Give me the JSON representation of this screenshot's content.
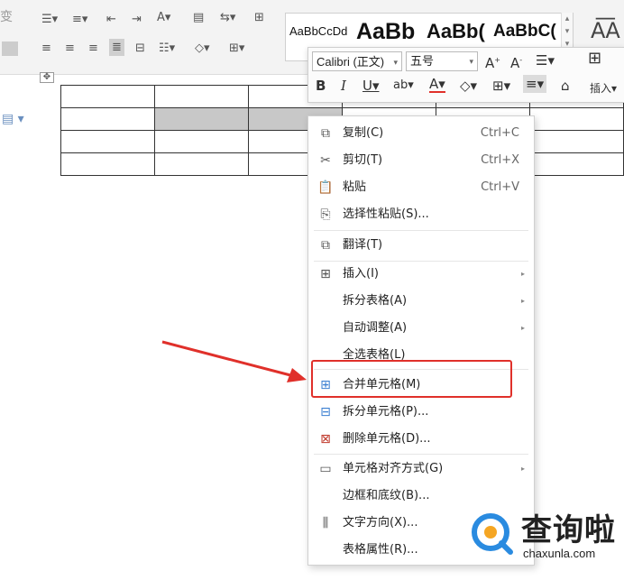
{
  "ribbon": {
    "partial_left_label": "变",
    "styles": [
      {
        "label": "AaBbCcDd",
        "size": "small"
      },
      {
        "label": "AaBb",
        "size": "large"
      },
      {
        "label": "AaBb(",
        "size": "large"
      },
      {
        "label": "AaBbC(",
        "size": "medium"
      }
    ]
  },
  "mini_toolbar": {
    "font_name": "Calibri (正文)",
    "font_size": "五号",
    "insert_label": "插入"
  },
  "table": {
    "rows": 4,
    "cols": 6
  },
  "context_menu": {
    "items": [
      {
        "label": "复制(C)",
        "shortcut": "Ctrl+C",
        "icon": "copy-icon"
      },
      {
        "label": "剪切(T)",
        "shortcut": "Ctrl+X",
        "icon": "cut-icon"
      },
      {
        "label": "粘贴",
        "shortcut": "Ctrl+V",
        "icon": "paste-icon"
      },
      {
        "label": "选择性粘贴(S)...",
        "icon": "paste-special-icon"
      },
      {
        "label": "翻译(T)",
        "icon": "translate-icon"
      },
      {
        "label": "插入(I)",
        "icon": "insert-table-icon",
        "submenu": true
      },
      {
        "label": "拆分表格(A)",
        "submenu": true
      },
      {
        "label": "自动调整(A)",
        "submenu": true
      },
      {
        "label": "全选表格(L)"
      },
      {
        "label": "合并单元格(M)",
        "icon": "merge-cells-icon"
      },
      {
        "label": "拆分单元格(P)...",
        "icon": "split-cells-icon"
      },
      {
        "label": "删除单元格(D)...",
        "icon": "delete-cells-icon"
      },
      {
        "label": "单元格对齐方式(G)",
        "icon": "cell-align-icon",
        "submenu": true
      },
      {
        "label": "边框和底纹(B)..."
      },
      {
        "label": "文字方向(X)...",
        "icon": "text-direction-icon"
      },
      {
        "label": "表格属性(R)..."
      }
    ]
  },
  "watermark": {
    "title": "查询啦",
    "url": "chaxunla.com"
  },
  "colors": {
    "highlight": "#e0302a",
    "arrow": "#e0302a",
    "selected_cell": "#c8c8c8"
  }
}
